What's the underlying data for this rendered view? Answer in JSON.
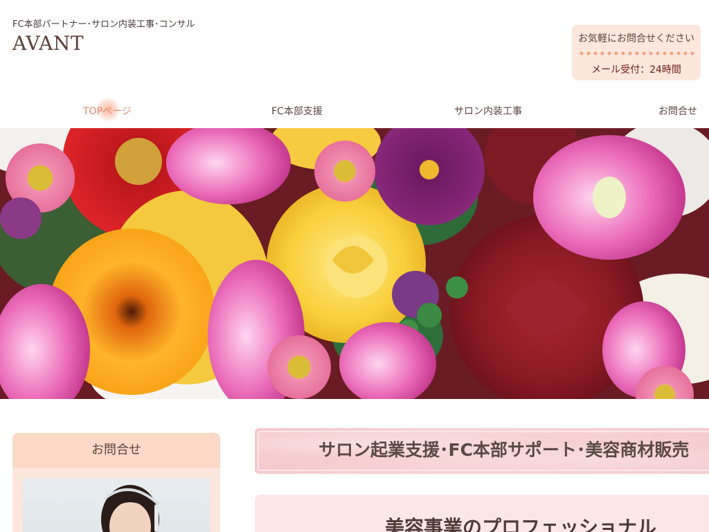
{
  "header": {
    "tagline": "FC本部パートナー･サロン内装工事･コンサル",
    "logo": "AVANT"
  },
  "contact_box": {
    "lead": "お気軽にお問合せください",
    "hours": "メール受付：24時間"
  },
  "nav": {
    "items": [
      {
        "label": "TOPページ",
        "active": true
      },
      {
        "label": "FC本部支援",
        "active": false
      },
      {
        "label": "サロン内装工事",
        "active": false
      },
      {
        "label": "お問合せ",
        "active": false
      }
    ]
  },
  "sidebar": {
    "contact_heading": "お問合せ"
  },
  "main": {
    "banner_text": "サロン起業支援･FC本部サポート･美容商材販売",
    "section_title": "美容事業のプロフェッショナル"
  },
  "colors": {
    "accent": "#e8876a",
    "contact_bg": "#fde6dc",
    "banner_bg": "#f5c9cc",
    "section_bg": "#fbe7e7",
    "hours_text": "#6a1f12"
  }
}
